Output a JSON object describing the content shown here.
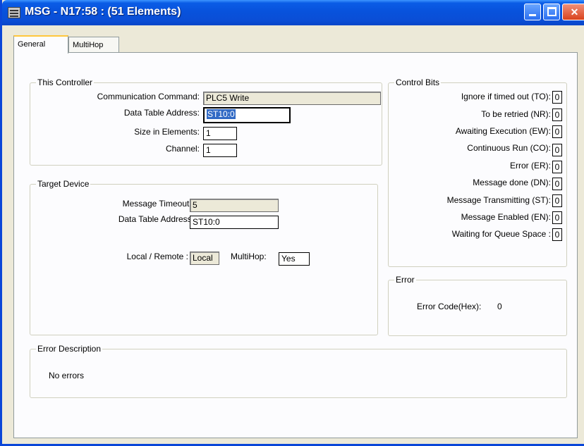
{
  "window": {
    "title": "MSG - N17:58 : (51 Elements)",
    "icon": "app-icon",
    "controls": {
      "minimize": "minimize-icon",
      "maximize": "maximize-icon",
      "close": "close-icon"
    }
  },
  "tabs": [
    {
      "label": "General",
      "active": true
    },
    {
      "label": "MultiHop",
      "active": false
    }
  ],
  "this_controller": {
    "legend": "This Controller",
    "communication_command_label": "Communication Command:",
    "communication_command_value": "PLC5 Write",
    "data_table_address_label": "Data Table Address:",
    "data_table_address_value": "ST10:0",
    "size_in_elements_label": "Size in Elements:",
    "size_in_elements_value": "1",
    "channel_label": "Channel:",
    "channel_value": "1"
  },
  "target_device": {
    "legend": "Target Device",
    "message_timeout_label": "Message Timeout :",
    "message_timeout_value": "5",
    "data_table_address_label": "Data Table Address:",
    "data_table_address_value": "ST10:0",
    "local_remote_label": "Local / Remote :",
    "local_remote_value": "Local",
    "multihop_label": "MultiHop:",
    "multihop_value": "Yes"
  },
  "control_bits": {
    "legend": "Control Bits",
    "items": [
      {
        "label": "Ignore if timed out (TO):",
        "value": "0"
      },
      {
        "label": "To be retried (NR):",
        "value": "0"
      },
      {
        "label": "Awaiting Execution (EW):",
        "value": "0"
      },
      {
        "label": "Continuous Run (CO):",
        "value": "0"
      },
      {
        "label": "Error (ER):",
        "value": "0"
      },
      {
        "label": "Message done (DN):",
        "value": "0"
      },
      {
        "label": "Message Transmitting (ST):",
        "value": "0"
      },
      {
        "label": "Message Enabled (EN):",
        "value": "0"
      },
      {
        "label": "Waiting for Queue Space :",
        "value": "0"
      }
    ]
  },
  "error": {
    "legend": "Error",
    "code_label": "Error Code(Hex):",
    "code_value": "0"
  },
  "error_description": {
    "legend": "Error Description",
    "text": "No errors"
  }
}
